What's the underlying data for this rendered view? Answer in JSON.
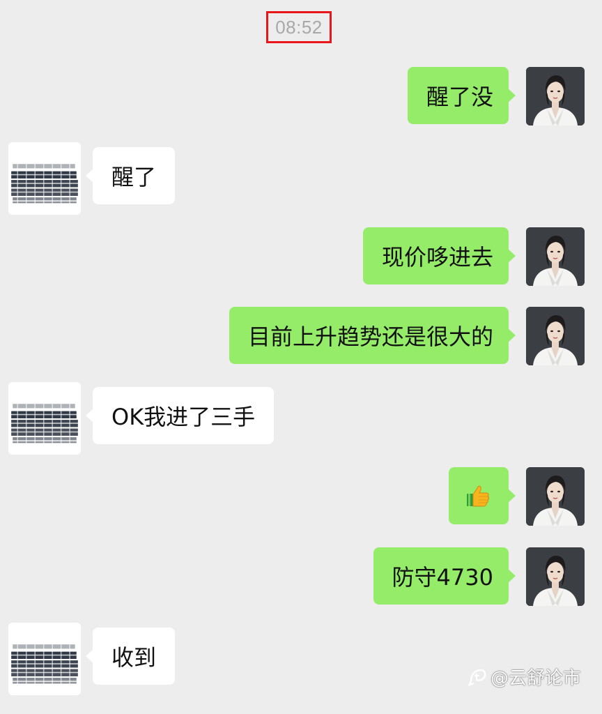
{
  "chat": {
    "timestamp": "08:52",
    "messages": [
      {
        "side": "right",
        "text": "醒了没"
      },
      {
        "side": "left",
        "text": "醒了"
      },
      {
        "side": "right",
        "text": "现价哆进去"
      },
      {
        "side": "right",
        "text": "目前上升趋势还是很大的"
      },
      {
        "side": "left",
        "text": "OK我进了三手"
      },
      {
        "side": "right",
        "text": "👍",
        "emoji": "thumbs-up"
      },
      {
        "side": "right",
        "text": "防守4730"
      },
      {
        "side": "left",
        "text": "收到"
      }
    ]
  },
  "watermark": {
    "text": "@云舒论市"
  },
  "colors": {
    "background": "#ededed",
    "outgoing_bubble": "#95ec69",
    "incoming_bubble": "#ffffff",
    "timestamp_text": "#a8a8a8",
    "highlight_box": "#e8161b"
  }
}
